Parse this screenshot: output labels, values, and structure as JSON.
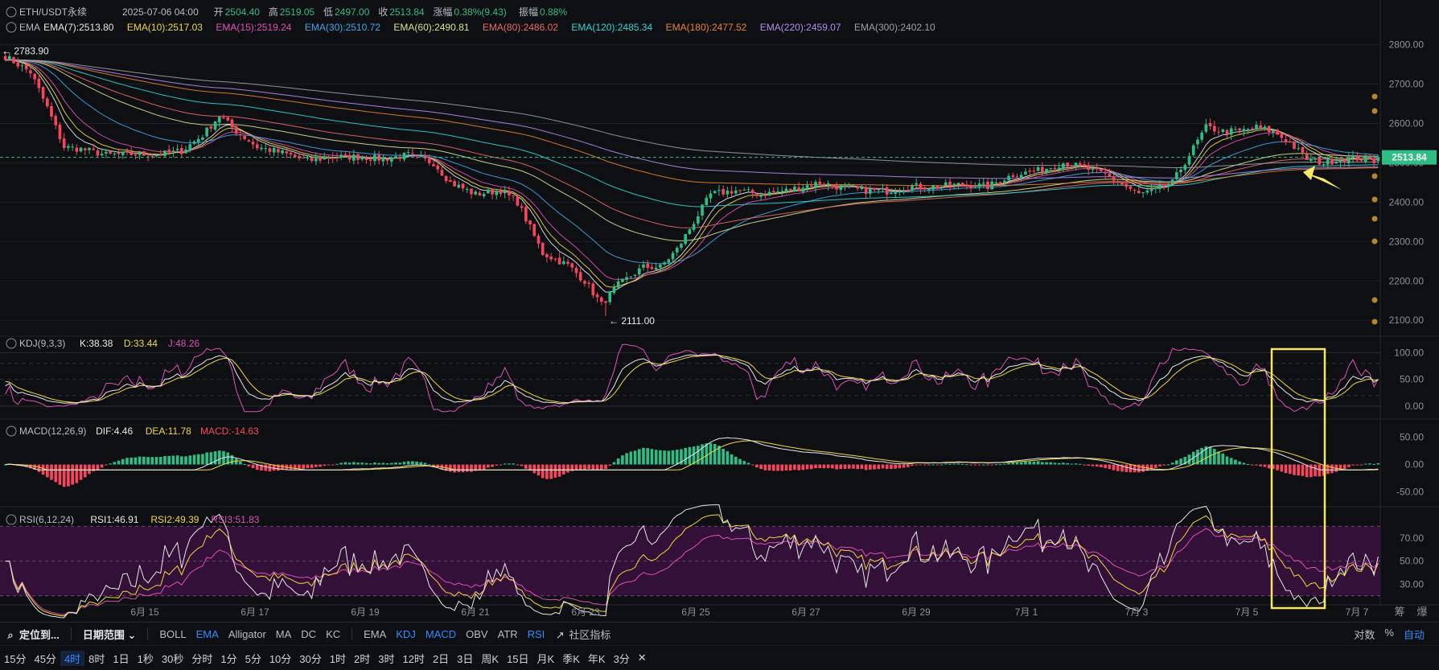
{
  "header": {
    "symbol": "ETH/USDT永续",
    "date": "2025-07-06 04:00",
    "open_label": "开",
    "open": "2504.40",
    "high_label": "高",
    "high": "2519.05",
    "low_label": "低",
    "low": "2497.00",
    "close_label": "收",
    "close": "2513.84",
    "change_label": "涨幅",
    "change": "0.38%(9.43)",
    "amp_label": "振幅",
    "amp": "0.88%"
  },
  "ema_legend": [
    {
      "label": "EMA",
      "color": "#b7bdc6"
    },
    {
      "label": "EMA(7):2513.80",
      "color": "#e8e8e8"
    },
    {
      "label": "EMA(10):2517.03",
      "color": "#f0d83c"
    },
    {
      "label": "EMA(15):2519.24",
      "color": "#e04fb7"
    },
    {
      "label": "EMA(30):2510.72",
      "color": "#3fa7e8"
    },
    {
      "label": "EMA(60):2490.81",
      "color": "#d6e38f"
    },
    {
      "label": "EMA(80):2486.02",
      "color": "#e86a6a"
    },
    {
      "label": "EMA(120):2485.34",
      "color": "#2dd4d4"
    },
    {
      "label": "EMA(180):2477.52",
      "color": "#e8822f"
    },
    {
      "label": "EMA(220):2459.07",
      "color": "#b48cf0"
    },
    {
      "label": "EMA(300):2402.10",
      "color": "#9aa0a8"
    }
  ],
  "price_axis": [
    "2800.00",
    "2700.00",
    "2600.00",
    "2500.00",
    "2400.00",
    "2300.00",
    "2200.00",
    "2100.00"
  ],
  "last_price": "2513.84",
  "annotations": {
    "high": "2783.90",
    "low": "2111.00"
  },
  "kdj": {
    "title": "KDJ(9,3,3)",
    "k": "K:38.38",
    "d": "D:33.44",
    "j": "J:48.26",
    "axis": [
      "100.00",
      "50.00",
      "0.00"
    ]
  },
  "macd": {
    "title": "MACD(12,26,9)",
    "dif": "DIF:4.46",
    "dea": "DEA:11.78",
    "macd": "MACD:-14.63",
    "axis": [
      "50.00",
      "0.00",
      "-50.00"
    ]
  },
  "rsi": {
    "title": "RSI(6,12,24)",
    "rsi1": "RSI1:46.91",
    "rsi2": "RSI2:49.39",
    "rsi3": "RSI3:51.83",
    "axis": [
      "70.00",
      "50.00",
      "30.00"
    ]
  },
  "x_labels": [
    "6月 15",
    "6月 17",
    "6月 19",
    "6月 21",
    "6月 23",
    "6月 25",
    "6月 27",
    "6月 29",
    "7月 1",
    "7月 3",
    "7月 5",
    "7月 7"
  ],
  "axis_corner": [
    "筹",
    "爆"
  ],
  "toolbar": {
    "locate": "定位到...",
    "date_range": "日期范围",
    "main_indicators": [
      {
        "label": "BOLL",
        "active": false
      },
      {
        "label": "EMA",
        "active": true
      },
      {
        "label": "Alligator",
        "active": false
      },
      {
        "label": "MA",
        "active": false
      },
      {
        "label": "DC",
        "active": false
      },
      {
        "label": "KC",
        "active": false
      }
    ],
    "sub_indicators": [
      {
        "label": "EMA",
        "active": false
      },
      {
        "label": "KDJ",
        "active": true
      },
      {
        "label": "MACD",
        "active": true
      },
      {
        "label": "OBV",
        "active": false
      },
      {
        "label": "ATR",
        "active": false
      },
      {
        "label": "RSI",
        "active": true
      }
    ],
    "community": "社区指标",
    "right": [
      "对数",
      "%",
      "自动"
    ]
  },
  "timeframes": [
    {
      "label": "15分",
      "active": false
    },
    {
      "label": "45分",
      "active": false
    },
    {
      "label": "4时",
      "active": true
    },
    {
      "label": "8时",
      "active": false
    },
    {
      "label": "1日",
      "active": false
    },
    {
      "label": "1秒",
      "active": false
    },
    {
      "label": "30秒",
      "active": false
    },
    {
      "label": "分时",
      "active": false
    },
    {
      "label": "1分",
      "active": false
    },
    {
      "label": "5分",
      "active": false
    },
    {
      "label": "10分",
      "active": false
    },
    {
      "label": "30分",
      "active": false
    },
    {
      "label": "1时",
      "active": false
    },
    {
      "label": "2时",
      "active": false
    },
    {
      "label": "3时",
      "active": false
    },
    {
      "label": "12时",
      "active": false
    },
    {
      "label": "2日",
      "active": false
    },
    {
      "label": "3日",
      "active": false
    },
    {
      "label": "周K",
      "active": false
    },
    {
      "label": "15日",
      "active": false
    },
    {
      "label": "月K",
      "active": false
    },
    {
      "label": "季K",
      "active": false
    },
    {
      "label": "年K",
      "active": false
    },
    {
      "label": "3分",
      "active": false
    }
  ],
  "colors": {
    "up": "#2ebd85",
    "down": "#f6465d",
    "bg": "#0e0f12",
    "grid": "#1c1f25",
    "highlight": "#f5e663",
    "rsi_band": "#3a1040"
  },
  "chart_data": {
    "type": "candlestick",
    "ylim": [
      2080,
      2840
    ],
    "anchors": [
      [
        0,
        2770
      ],
      [
        6,
        2730
      ],
      [
        10,
        2640
      ],
      [
        14,
        2540
      ],
      [
        18,
        2535
      ],
      [
        24,
        2520
      ],
      [
        30,
        2522
      ],
      [
        36,
        2520
      ],
      [
        42,
        2530
      ],
      [
        47,
        2570
      ],
      [
        51,
        2620
      ],
      [
        55,
        2580
      ],
      [
        60,
        2540
      ],
      [
        66,
        2525
      ],
      [
        72,
        2505
      ],
      [
        78,
        2515
      ],
      [
        84,
        2515
      ],
      [
        90,
        2510
      ],
      [
        96,
        2520
      ],
      [
        102,
        2500
      ],
      [
        106,
        2450
      ],
      [
        112,
        2420
      ],
      [
        118,
        2430
      ],
      [
        122,
        2400
      ],
      [
        128,
        2270
      ],
      [
        134,
        2240
      ],
      [
        138,
        2200
      ],
      [
        142,
        2140
      ],
      [
        146,
        2190
      ],
      [
        152,
        2235
      ],
      [
        156,
        2235
      ],
      [
        160,
        2280
      ],
      [
        164,
        2350
      ],
      [
        168,
        2420
      ],
      [
        174,
        2430
      ],
      [
        180,
        2420
      ],
      [
        186,
        2430
      ],
      [
        190,
        2440
      ],
      [
        194,
        2450
      ],
      [
        198,
        2440
      ],
      [
        204,
        2430
      ],
      [
        210,
        2428
      ],
      [
        216,
        2440
      ],
      [
        222,
        2440
      ],
      [
        228,
        2445
      ],
      [
        234,
        2440
      ],
      [
        240,
        2470
      ],
      [
        246,
        2480
      ],
      [
        252,
        2500
      ],
      [
        256,
        2490
      ],
      [
        262,
        2470
      ],
      [
        266,
        2445
      ],
      [
        270,
        2420
      ],
      [
        274,
        2430
      ],
      [
        278,
        2450
      ],
      [
        282,
        2520
      ],
      [
        286,
        2590
      ],
      [
        290,
        2580
      ],
      [
        294,
        2580
      ],
      [
        298,
        2590
      ],
      [
        302,
        2580
      ],
      [
        306,
        2550
      ],
      [
        310,
        2510
      ],
      [
        314,
        2500
      ],
      [
        318,
        2510
      ],
      [
        322,
        2512
      ],
      [
        326,
        2505
      ],
      [
        327,
        2514
      ]
    ],
    "kdj_last": {
      "k": 38.38,
      "d": 33.44,
      "j": 48.26
    },
    "macd_last": {
      "dif": 4.46,
      "dea": 11.78,
      "macd": -14.63
    },
    "rsi_last": {
      "rsi1": 46.91,
      "rsi2": 49.39,
      "rsi3": 51.83
    }
  }
}
